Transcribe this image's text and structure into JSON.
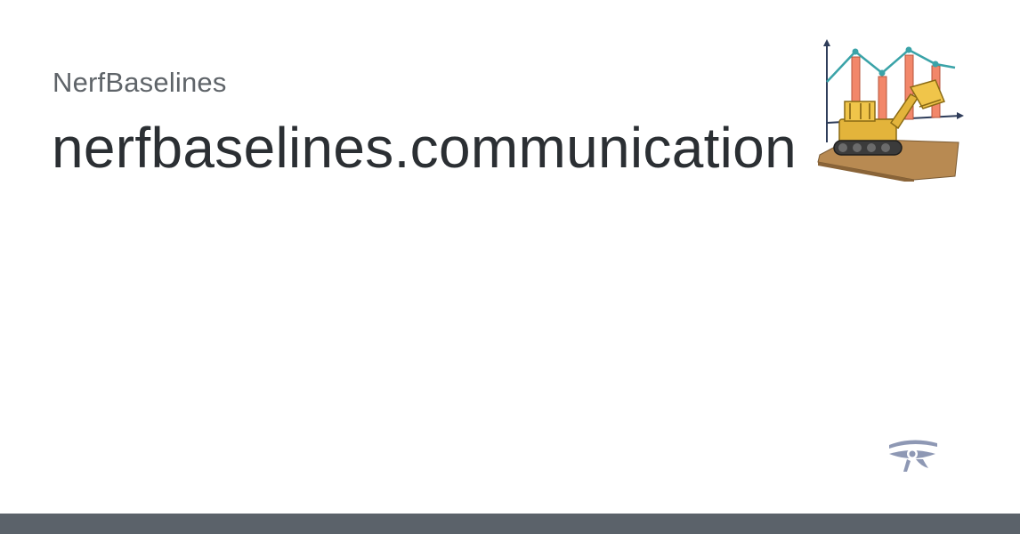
{
  "site": {
    "name": "NerfBaselines"
  },
  "page": {
    "title": "nerfbaselines.communication"
  },
  "icons": {
    "logo": "nerfbaselines-logo",
    "footer_icon": "eye-of-horus-icon"
  },
  "colors": {
    "site_name": "#5f6469",
    "title": "#2b2f33",
    "bottom_bar": "#5b626a",
    "chart_line": "#3aa3a8",
    "chart_bar": "#f2876a",
    "footer_icon": "#8e98b4"
  }
}
